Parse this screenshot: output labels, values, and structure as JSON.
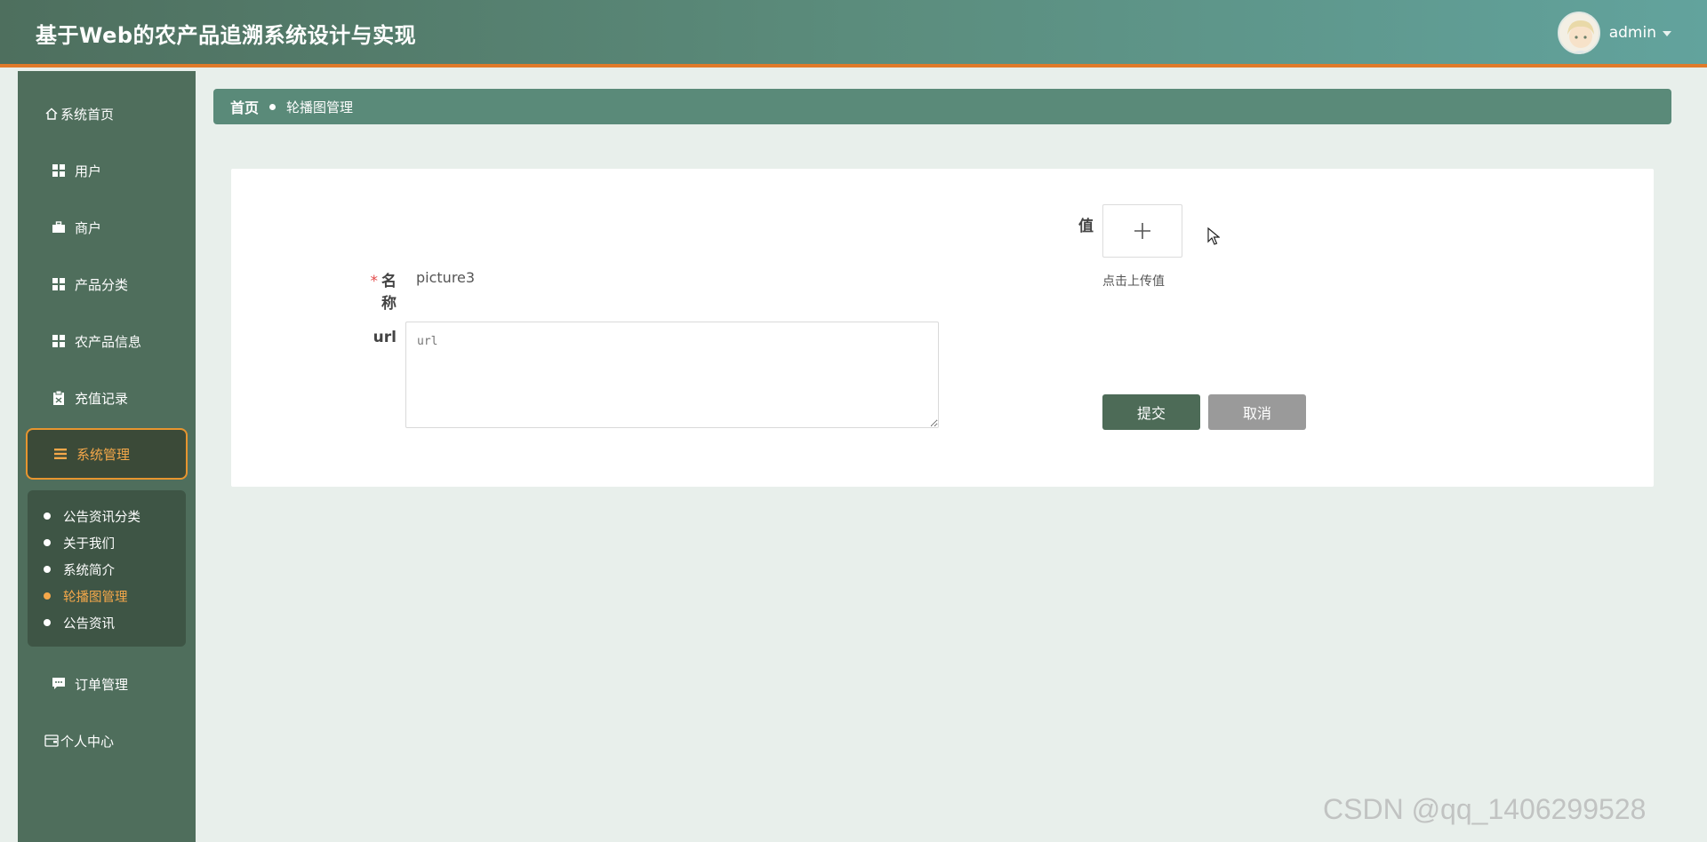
{
  "header": {
    "app_title": "基于Web的农产品追溯系统设计与实现",
    "username": "admin"
  },
  "sidebar": {
    "items": [
      {
        "label": "系统首页",
        "icon": "home-icon"
      },
      {
        "label": "用户",
        "icon": "grid-icon"
      },
      {
        "label": "商户",
        "icon": "briefcase-icon"
      },
      {
        "label": "产品分类",
        "icon": "grid-icon"
      },
      {
        "label": "农产品信息",
        "icon": "grid-icon"
      },
      {
        "label": "充值记录",
        "icon": "clipboard-icon"
      },
      {
        "label": "系统管理",
        "icon": "menu-icon",
        "active": true
      },
      {
        "label": "订单管理",
        "icon": "chat-icon"
      },
      {
        "label": "个人中心",
        "icon": "wallet-icon"
      }
    ],
    "submenu": [
      {
        "label": "公告资讯分类"
      },
      {
        "label": "关于我们"
      },
      {
        "label": "系统简介"
      },
      {
        "label": "轮播图管理",
        "active": true
      },
      {
        "label": "公告资讯"
      }
    ]
  },
  "breadcrumb": {
    "home": "首页",
    "current": "轮播图管理"
  },
  "form": {
    "name_label": "名称",
    "name_required_mark": "*",
    "name_value": "picture3",
    "url_label": "url",
    "url_placeholder": "url",
    "value_label": "值",
    "upload_hint": "点击上传值",
    "submit_label": "提交",
    "cancel_label": "取消"
  },
  "watermark": "CSDN @qq_1406299528",
  "colors": {
    "accent_orange": "#e7952f",
    "header_green": "#5b8c7c",
    "sidebar_green": "#4f6e5c",
    "submit_green": "#4d6b57"
  }
}
